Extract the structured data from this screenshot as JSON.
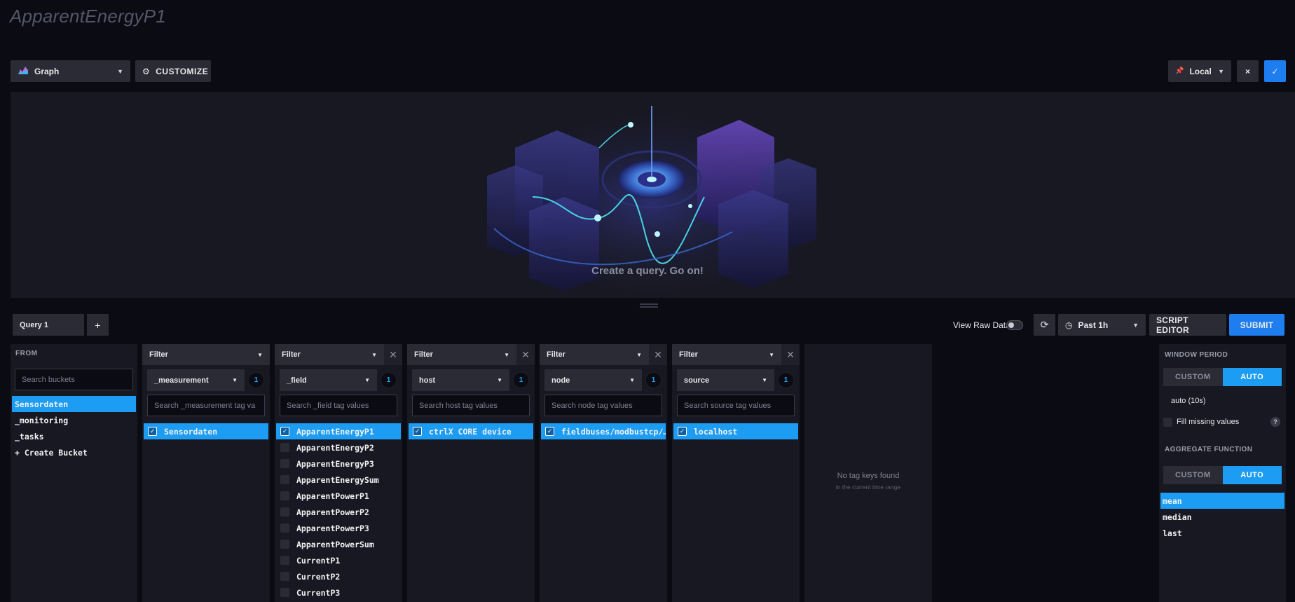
{
  "page": {
    "title": "ApparentEnergyP1"
  },
  "toolbar": {
    "graph_type": "Graph",
    "customize": "CUSTOMIZE",
    "timezone": "Local",
    "cancel_icon": "×",
    "confirm_icon": "✓"
  },
  "graph": {
    "empty_message": "Create a query. Go on!"
  },
  "query_bar": {
    "tab": "Query 1",
    "add": "+",
    "view_raw": "View Raw Data",
    "time_range": "Past 1h",
    "script_editor": "SCRIPT EDITOR",
    "submit": "SUBMIT"
  },
  "from": {
    "label": "FROM",
    "search_placeholder": "Search buckets",
    "buckets": [
      "Sensordaten",
      "_monitoring",
      "_tasks",
      "+ Create Bucket"
    ],
    "selected": "Sensordaten"
  },
  "filters": [
    {
      "head": "Filter",
      "key": "_measurement",
      "count": "1",
      "search_placeholder": "Search _measurement tag va",
      "values": [
        {
          "label": "Sensordaten",
          "checked": true
        }
      ]
    },
    {
      "head": "Filter",
      "key": "_field",
      "count": "1",
      "search_placeholder": "Search _field tag values",
      "values": [
        {
          "label": "ApparentEnergyP1",
          "checked": true
        },
        {
          "label": "ApparentEnergyP2",
          "checked": false
        },
        {
          "label": "ApparentEnergyP3",
          "checked": false
        },
        {
          "label": "ApparentEnergySum",
          "checked": false
        },
        {
          "label": "ApparentPowerP1",
          "checked": false
        },
        {
          "label": "ApparentPowerP2",
          "checked": false
        },
        {
          "label": "ApparentPowerP3",
          "checked": false
        },
        {
          "label": "ApparentPowerSum",
          "checked": false
        },
        {
          "label": "CurrentP1",
          "checked": false
        },
        {
          "label": "CurrentP2",
          "checked": false
        },
        {
          "label": "CurrentP3",
          "checked": false
        }
      ]
    },
    {
      "head": "Filter",
      "key": "host",
      "count": "1",
      "search_placeholder": "Search host tag values",
      "values": [
        {
          "label": "ctrlX CORE device",
          "checked": true
        }
      ]
    },
    {
      "head": "Filter",
      "key": "node",
      "count": "1",
      "search_placeholder": "Search node tag values",
      "values": [
        {
          "label": "fieldbuses/modbustcp/…",
          "checked": true
        }
      ]
    },
    {
      "head": "Filter",
      "key": "source",
      "count": "1",
      "search_placeholder": "Search source tag values",
      "values": [
        {
          "label": "localhost",
          "checked": true
        }
      ]
    }
  ],
  "empty_panel": {
    "message": "No tag keys found",
    "sub": "in the current time range"
  },
  "aggregate": {
    "window_label": "WINDOW PERIOD",
    "custom": "CUSTOM",
    "auto": "AUTO",
    "auto_value": "auto (10s)",
    "fill_missing": "Fill missing values",
    "help": "?",
    "function_label": "AGGREGATE FUNCTION",
    "functions": [
      "mean",
      "median",
      "last"
    ],
    "selected": "mean"
  },
  "colors": {
    "accent": "#1c9cf2",
    "primary": "#1e7ef0",
    "panel": "#181822",
    "background": "#0b0b13"
  }
}
